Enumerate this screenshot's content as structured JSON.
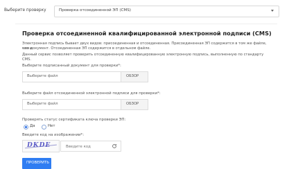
{
  "top": {
    "label": "Выберите проверку",
    "select_value": "Проверка отсоединенной ЭП (CMS)"
  },
  "main": {
    "title": "Проверка отсоединенной квалифицированной электронной подписи (CMS)",
    "para1_line1": "Электронная подпись бывает двух видов: присоединенная и отсоединенная. Присоединенная ЭП содержится в том же файле, что и",
    "para1_line2": "сам документ. Отсоединенная ЭП содержится в отдельном файле.",
    "para2": "Данный сервис позволяет проверить отсоединенную квалифицированную электронную подпись, выполненную по стандарту CMS.",
    "doc_label": "Выберите подписанный документ для проверки*:",
    "doc_placeholder": "Выберите файл",
    "doc_button": "ОБЗОР",
    "sig_label": "Выберите файл отсоединенной электронной подписи для проверки*:",
    "sig_placeholder": "Выберите файл",
    "sig_button": "ОБЗОР",
    "status_label": "Проверять статус сертификата ключа проверки ЭП:",
    "radio_yes": "Да",
    "radio_no": "Нет",
    "captcha_label": "Введите код на изображении*:",
    "captcha_text": "DKDE",
    "code_placeholder": "Введите код",
    "submit": "ПРОВЕРИТЬ"
  },
  "icons": {
    "dropdown": "chevron-down-icon",
    "refresh": "refresh-icon"
  },
  "colors": {
    "accent": "#2f7df2",
    "captcha": "#5c5cc7"
  }
}
